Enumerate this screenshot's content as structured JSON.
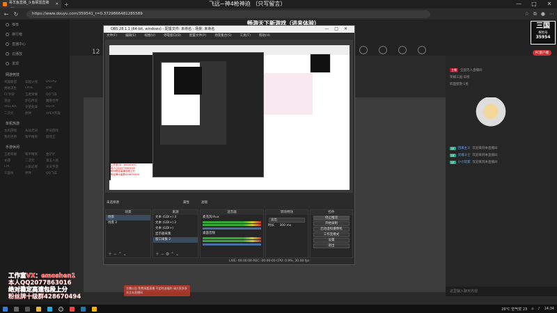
{
  "browser": {
    "tab_title": "哥羊鱼直播_斗鱼联盟直播_... ",
    "center_title": "飞远~神4枪神迫 （只写留言）",
    "url": "https://www.douyu.com/359541_r=0.3729866481285589",
    "window_controls": [
      "—",
      "□",
      "✕"
    ]
  },
  "page": {
    "stream_title": "畅游天下新游戏（进来体验）",
    "logo": {
      "line1": "三国",
      "line2": "探险号",
      "line3": "35954"
    },
    "header_counter": "12",
    "chat_placeholder": "这里输入聊天内容",
    "notice_text": "主播公告 免费观看直播 不定时送福利 请大家多多关注本直播间"
  },
  "sidebar": {
    "items": [
      {
        "label": "推荐",
        "icon": "home-icon"
      },
      {
        "label": "排行榜",
        "icon": "rank-icon"
      },
      {
        "label": "直播中心",
        "icon": "live-icon"
      },
      {
        "label": "云播放",
        "icon": "cloud-icon"
      },
      {
        "label": "发现",
        "icon": "discover-icon"
      }
    ],
    "sections": [
      {
        "title": "网游竞技",
        "cats": [
          "英雄联盟",
          "穿越火线",
          "DOTA2",
          "绝地求生",
          "LPHE",
          "DNF",
          "CF手游",
          "王者荣耀",
          "QQ飞车",
          "逆战",
          "炉石传说",
          "魔兽世界",
          "VALORA",
          "守望先锋",
          "DOTA",
          "二次元",
          "原神",
          "APEX英雄"
        ]
      },
      {
        "title": "单机热游",
        "cats": [
          "主机游戏",
          "永劫无间",
          "怀旧游戏",
          "我的世界",
          "和平精英",
          "游戏王"
        ]
      },
      {
        "title": "手游休闲",
        "cats": [
          "王者荣耀",
          "和平精英",
          "金铲铲",
          "光遇",
          "二次元",
          "第五人格",
          "LTK",
          "火影忍者",
          "天天手游",
          "三国杀",
          "原神",
          "QQ飞车"
        ]
      }
    ]
  },
  "right_panel": {
    "rows": [
      {
        "badge": "主播",
        "text": "全国无人直播间"
      },
      {
        "badge": "",
        "text": "荣耀三国·日榜"
      },
      {
        "badge": "",
        "text": "四面楚歌·1星"
      }
    ],
    "chat": [
      {
        "tag": "LV",
        "user": "回来主义",
        "msg": "欢迎来到本直播间"
      },
      {
        "tag": "LV",
        "user": "灵魂斗士",
        "msg": "欢迎来到本直播间"
      },
      {
        "tag": "LV",
        "user": "小小玩家",
        "msg": "欢迎来到本直播间"
      }
    ],
    "pk_label": "PC客户端"
  },
  "obs": {
    "title": "OBS 28.1.1 (64-bit, windows) - 配置文件: 未命名 - 场景: 未命名",
    "menu": [
      "文件(F)",
      "编辑(E)",
      "视图(V)",
      "停靠窗口(D)",
      "配置文件(P)",
      "场景集合(S)",
      "工具(T)",
      "帮助(H)"
    ],
    "docks_header": "未选择源",
    "tabs": [
      "属性",
      "滤镜"
    ],
    "scenes": {
      "title": "场景",
      "items": [
        "场景",
        "场景 2"
      ]
    },
    "sources": {
      "title": "来源",
      "items": [
        "文本 (GDI+) 3",
        "文本 (GDI+) 2",
        "文本 (GDI+)",
        "显示器采集",
        "窗口采集 2"
      ]
    },
    "mixer": {
      "title": "混音器",
      "tracks": [
        "麦克风/Aux",
        "桌面音频"
      ]
    },
    "transitions": {
      "title": "转场特效",
      "type": "淡出",
      "duration_label": "时长",
      "duration": "300 ms"
    },
    "controls": {
      "title": "控件",
      "buttons": [
        "停止推流",
        "开始录制",
        "启动虚拟摄像机",
        "工作室模式",
        "设置",
        "退出"
      ]
    },
    "status": "LIVE: 00:00:00   REC: 00:00:00   CPU: 0.9%, 30.00 fps"
  },
  "promo": [
    "工作室VX：emoshen1",
    "本人QQ2077863016",
    "绝对稳定高速包段上分",
    "粉丝牌十级群428670494"
  ],
  "taskbar": {
    "weather": "26°C 空气优 23",
    "time": "14:34",
    "icons": [
      "start-icon",
      "search-icon",
      "taskview-icon",
      "explorer-icon",
      "edge-icon",
      "obs-icon",
      "chrome-icon",
      "store-icon",
      "folder-icon"
    ]
  }
}
